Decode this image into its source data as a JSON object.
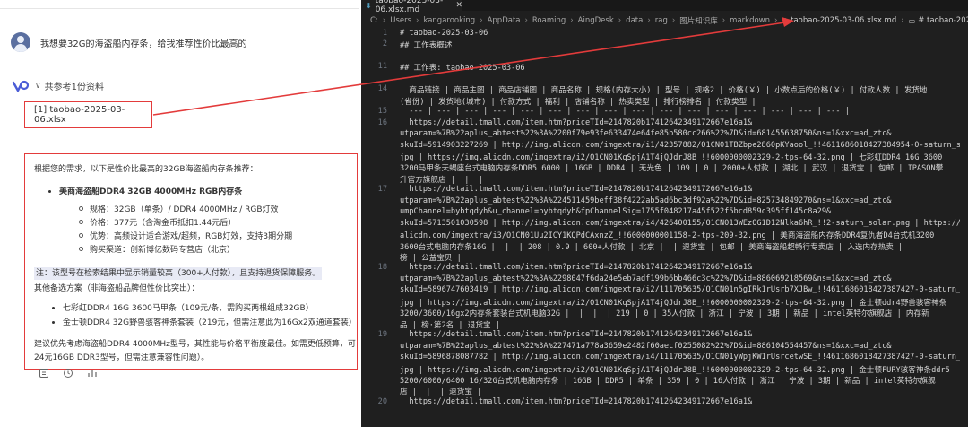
{
  "chat": {
    "user_message": "我想要32G的海盗船内存条，给我推荐性价比最高的",
    "reference_label": "共参考1份资料",
    "reference_file": "[1] taobao-2025-03-06.xlsx",
    "answer": {
      "intro": "根据您的需求，以下是性价比最高的32GB海盗船内存条推荐：",
      "product_title": "美商海盗船DDR4 32GB 4000MHz RGB内存条",
      "specs": [
        "规格：32GB（单条）/ DDR4 4000MHz / RGB灯效",
        "价格：377元（含淘金币抵扣1.44元后）",
        "优势：高频设计适合游戏/超频，RGB灯效，支持3期分期",
        "购买渠道：创新博亿数码专营店（北京）"
      ],
      "note": "注：该型号在检索结果中显示销量较高（300+人付款），且支持退货保障服务。",
      "alt_title": "其他备选方案（非海盗船品牌但性价比突出）：",
      "alts": [
        "七彩虹DDR4 16G 3600马甲条（109元/条，需购买两根组成32GB）",
        "金士顿DDR4 32G野兽骇客神条套装（219元，但需注意此为16Gx2双通道套装）"
      ],
      "conclusion_1": "建议优先考虑海盗船DDR4 4000MHz型号，其性能与价格平衡度最佳。如需更低预算，可",
      "conclusion_2": "24元16GB DDR3型号，但需注意兼容性问题）。"
    },
    "actions": [
      "copy-icon",
      "refresh-icon",
      "share-icon"
    ]
  },
  "editor": {
    "tab_title": "taobao-2025-03-06.xlsx.md",
    "breadcrumb": [
      "C:",
      "Users",
      "kangarooking",
      "AppData",
      "Roaming",
      "AingDesk",
      "data",
      "rag",
      "图片知识库",
      "markdown",
      "taobao-2025-03-06.xlsx.md",
      "# taobao-2025-03-06"
    ],
    "lines": [
      {
        "n": "1",
        "t": "# taobao-2025-03-06"
      },
      {
        "n": "2",
        "t": "## 工作表概述"
      },
      {
        "n": "",
        "t": ""
      },
      {
        "n": "11",
        "t": "## 工作表: taobao-2025-03-06"
      },
      {
        "n": "",
        "t": ""
      },
      {
        "n": "14",
        "t": "| 商品链接 | 商品主图 | 商品店铺图 | 商品名称 | 规格(内存大小) | 型号 | 规格2 | 价格(￥) | 小数点后的价格(￥) | 付款人数 | 发货地"
      },
      {
        "n": "",
        "t": "(省份) | 发货地(城市) | 付款方式 | 福利 | 店铺名称 | 热卖类型 | 排行榜排名 | 付款类型 |"
      },
      {
        "n": "15",
        "t": "| --- | --- | --- | --- | --- | --- | --- | --- | --- | --- | --- | --- | --- | --- | --- | --- |"
      },
      {
        "n": "16",
        "t": "| https://detail.tmall.com/item.htm?priceTId=2147820b17412642349172667e16a1&"
      },
      {
        "n": "",
        "t": "utparam=%7B%22aplus_abtest%22%3A%2200f79e93fe633474e64fe85b580cc266%22%7D&id=681455638750&ns=1&xxc=ad_ztc&"
      },
      {
        "n": "",
        "t": "skuId=5914903227269 | http://img.alicdn.com/imgextra/i1/42357882/O1CN01TBZbpe2860pKYaool_!!4611686018427384954-0-saturn_solar."
      },
      {
        "n": "",
        "t": "jpg | https://img.alicdn.com/imgextra/i2/O1CN01KqSpjA1T4jQJdrJ8B_!!6000000002329-2-tps-64-32.png | 七彩虹DDR4 16G 3600"
      },
      {
        "n": "",
        "t": "3200马甲条天蝎座台式电脑内存条DDR5 6000 | 16GB | DDR4 | 无光色 | 109 | 0 | 2000+人付款 | 湖北 | 武汉 | 退货宝 | 包邮 | IPASON攀"
      },
      {
        "n": "",
        "t": "升官方旗舰店 |  |  |"
      },
      {
        "n": "17",
        "t": "| https://detail.tmall.com/item.htm?priceTId=2147820b17412642349172667e16a1&"
      },
      {
        "n": "",
        "t": "utparam=%7B%22aplus_abtest%22%3A%224511459beff38f4222ab5ad6bc3df92a%22%7D&id=825734849270&ns=1&xxc=ad_ztc&"
      },
      {
        "n": "",
        "t": "umpChannel=bybtqdyh&u_channel=bybtqdyh&fpChannelSig=1755f048217a45f522f5bcd859c395ff145c8a29&"
      },
      {
        "n": "",
        "t": "skuId=5713501030598 | http://img.alicdn.com/imgextra/i4/426400155/O1CN013WEzOG1D12Nlka6hR_!!2-saturn_solar.png | https://img."
      },
      {
        "n": "",
        "t": "alicdn.com/imgextra/i3/O1CN01Uu2ICY1KQPdCAxnzZ_!!6000000001158-2-tps-209-32.png | 美商海盗船内存条DDR4复仇者D4台式机3200"
      },
      {
        "n": "",
        "t": "3600台式电脑内存条16G |  |  | 208 | 0.9 | 600+人付款 | 北京 |  | 退货宝 | 包邮 | 美商海盗船超畅行专卖店 | 入选内存热卖 |"
      },
      {
        "n": "",
        "t": "榜 | 公益宝贝 |"
      },
      {
        "n": "18",
        "t": "| https://detail.tmall.com/item.htm?priceTId=2147820b17412642349172667e16a1&"
      },
      {
        "n": "",
        "t": "utparam=%7B%22aplus_abtest%22%3A%2298047f6da24e5eb7adf199b6bb466c3c%22%7D&id=886069218569&ns=1&xxc=ad_ztc&"
      },
      {
        "n": "",
        "t": "skuId=5896747603419 | http://img.alicdn.com/imgextra/i2/111705635/O1CN01n5gIRk1rUsrb7XJBw_!!4611686018427387427-0-saturn_solar."
      },
      {
        "n": "",
        "t": "jpg | https://img.alicdn.com/imgextra/i2/O1CN01KqSpjA1T4jQJdrJ8B_!!6000000002329-2-tps-64-32.png | 金士顿ddr4野兽骇客神条"
      },
      {
        "n": "",
        "t": "3200/3600/16gx2内存条套装台式机电脑32G |  |  |  | 219 | 0 | 35人付款 | 浙江 | 宁波 | 3期 | 新品 | intel英特尔旗舰店 | 内存新"
      },
      {
        "n": "",
        "t": "品 | 榜·第2名 | 退货宝 |"
      },
      {
        "n": "19",
        "t": "| https://detail.tmall.com/item.htm?priceTId=2147820b17412642349172667e16a1&"
      },
      {
        "n": "",
        "t": "utparam=%7B%22aplus_abtest%22%3A%227471a778a3659e2482f60aecf0255082%22%7D&id=886104554457&ns=1&xxc=ad_ztc&"
      },
      {
        "n": "",
        "t": "skuId=5896878087782 | http://img.alicdn.com/imgextra/i4/111705635/O1CN01yWpjKW1rUsrcetwSE_!!4611686018427387427-0-saturn_solar."
      },
      {
        "n": "",
        "t": "jpg | https://img.alicdn.com/imgextra/i2/O1CN01KqSpjA1T4jQJdrJ8B_!!6000000002329-2-tps-64-32.png | 金士顿FURY骇客神条ddr5"
      },
      {
        "n": "",
        "t": "5200/6000/6400 16/32G台式机电脑内存条 | 16GB | DDR5 | 单条 | 359 | 0 | 16人付款 | 浙江 | 宁波 | 3期 | 新品 | intel英特尔旗舰"
      },
      {
        "n": "",
        "t": "店 |  |  | 退货宝 |"
      },
      {
        "n": "20",
        "t": "| https://detail.tmall.com/item.htm?priceTId=2147820b17412642349172667e16a1&"
      }
    ]
  },
  "colors": {
    "highlight_red": "#e33b3b",
    "editor_bg": "#1f1f1f",
    "editor_text": "#d4d4d4",
    "line_number": "#6e7681"
  }
}
